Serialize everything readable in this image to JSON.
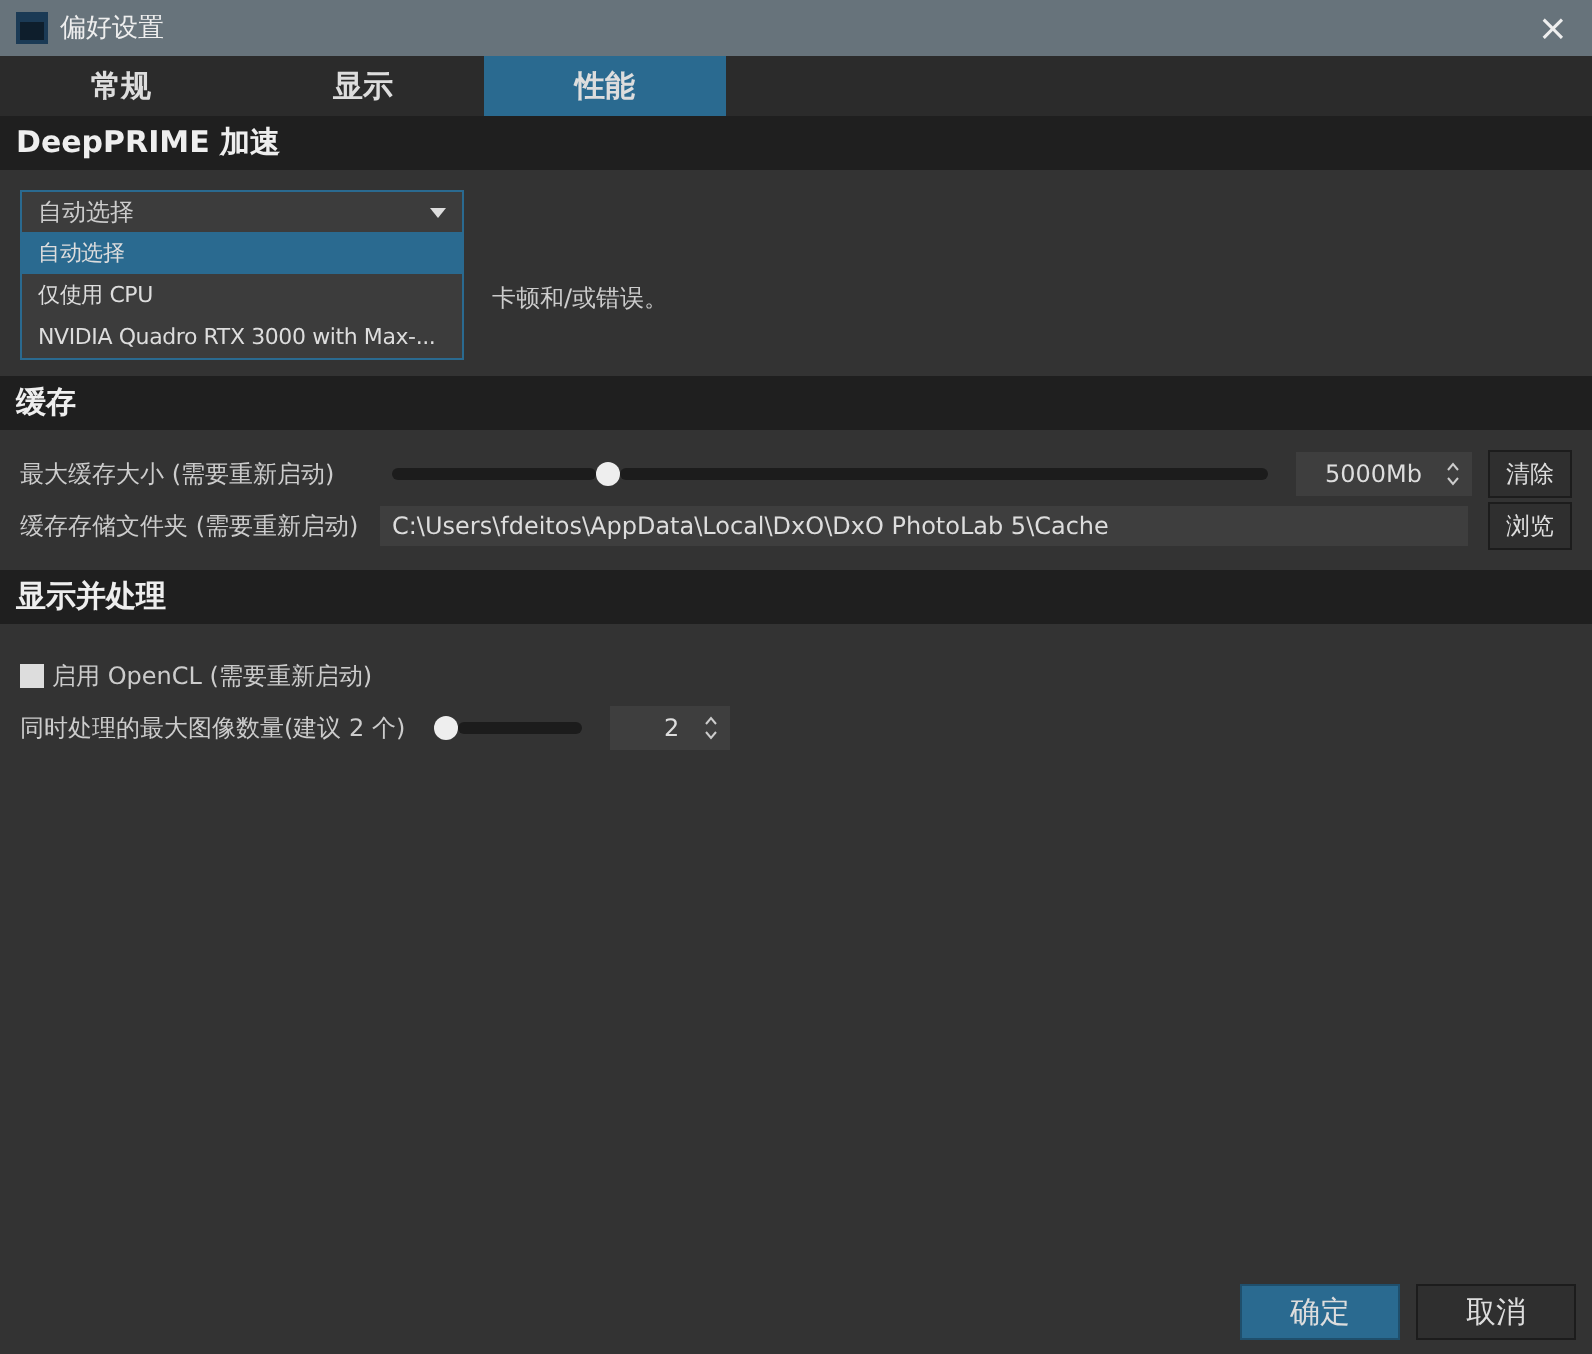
{
  "window": {
    "title": "偏好设置",
    "close": "×"
  },
  "tabs": [
    {
      "label": "常规",
      "selected": false
    },
    {
      "label": "显示",
      "selected": false
    },
    {
      "label": "性能",
      "selected": true
    }
  ],
  "deepprime": {
    "title": "DeepPRIME 加速",
    "dropdown": {
      "value": "自动选择",
      "options": [
        {
          "label": "自动选择",
          "selected": true
        },
        {
          "label": "仅使用 CPU",
          "selected": false
        },
        {
          "label": "NVIDIA Quadro RTX 3000 with Max-...",
          "selected": false
        }
      ]
    },
    "note": "卡顿和/或错误。"
  },
  "cache": {
    "title": "缓存",
    "size_label": "最大缓存大小 (需要重新启动)",
    "level": 0.24,
    "size_value": "5000Mb",
    "clear_button": "清除",
    "folder_label": "缓存存储文件夹 (需要重新启动)",
    "folder_value": "C:\\Users\\fdeitos\\AppData\\Local\\DxO\\DxO PhotoLab 5\\Cache",
    "browse_button": "浏览"
  },
  "processing": {
    "title": "显示并处理",
    "opencl": {
      "label": "启用 OpenCL (需要重新启动)",
      "checked": false
    },
    "max_images_label": "同时处理的最大图像数量(建议 2 个)",
    "level": 0,
    "max_images_value": "2"
  },
  "buttons": [
    {
      "label": "确定",
      "kind": "primary"
    },
    {
      "label": "取消",
      "kind": "secondary"
    }
  ]
}
